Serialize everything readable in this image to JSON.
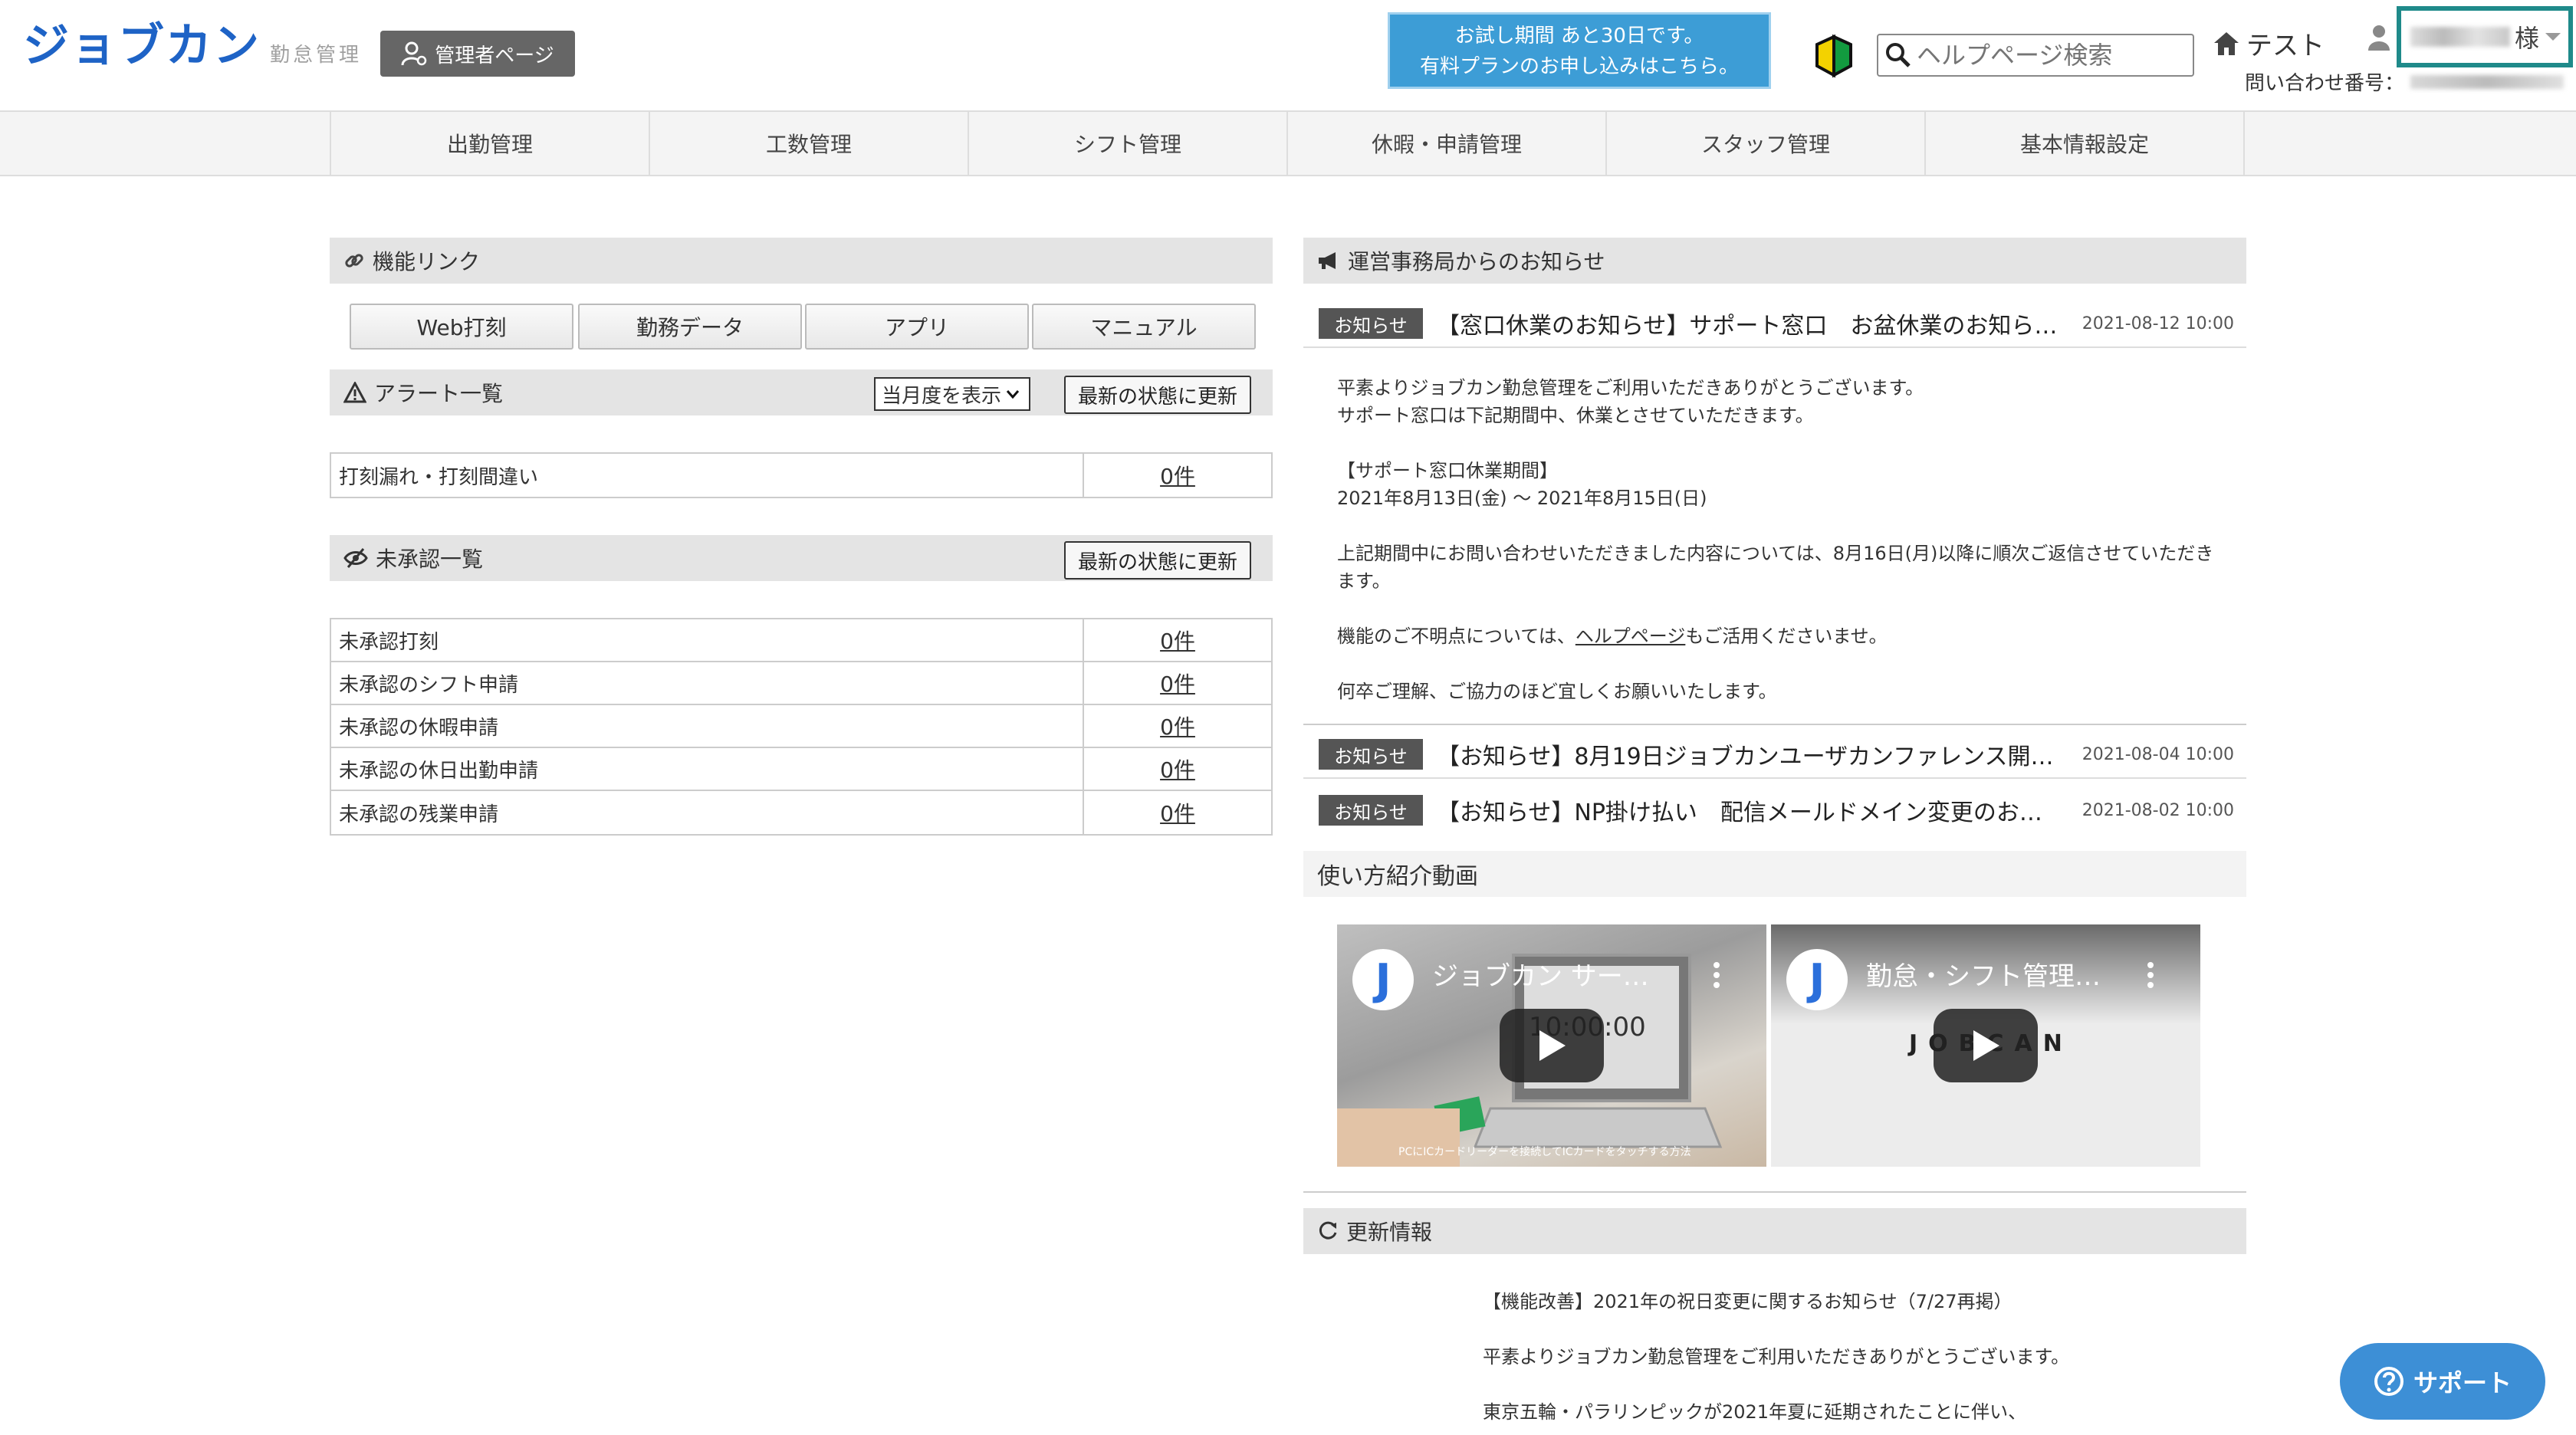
{
  "header": {
    "logo_main": "ジョブカン",
    "logo_sub": "勤怠管理",
    "admin_page_label": "管理者ページ",
    "trial_line1": "お試し期間 あと30日です。",
    "trial_line2": "有料プランのお申し込みはこちら。",
    "search_placeholder": "ヘルプページ検索",
    "home_label": "テスト",
    "user_suffix": "様",
    "contact_label": "問い合わせ番号："
  },
  "nav": {
    "items": [
      "出勤管理",
      "工数管理",
      "シフト管理",
      "休暇・申請管理",
      "スタッフ管理",
      "基本情報設定"
    ]
  },
  "function_links": {
    "title": "機能リンク",
    "buttons": [
      "Web打刻",
      "勤務データ",
      "アプリ",
      "マニュアル"
    ]
  },
  "alerts": {
    "title": "アラート一覧",
    "period_select": "当月度を表示",
    "refresh_label": "最新の状態に更新",
    "rows": [
      {
        "label": "打刻漏れ・打刻間違い",
        "count": "0件"
      }
    ]
  },
  "unapproved": {
    "title": "未承認一覧",
    "refresh_label": "最新の状態に更新",
    "rows": [
      {
        "label": "未承認打刻",
        "count": "0件"
      },
      {
        "label": "未承認のシフト申請",
        "count": "0件"
      },
      {
        "label": "未承認の休暇申請",
        "count": "0件"
      },
      {
        "label": "未承認の休日出勤申請",
        "count": "0件"
      },
      {
        "label": "未承認の残業申請",
        "count": "0件"
      }
    ]
  },
  "notices": {
    "title": "運営事務局からのお知らせ",
    "items": [
      {
        "badge": "お知らせ",
        "title": "【窓口休業のお知らせ】サポート窓口　お盆休業のお知ら…",
        "date": "2021-08-12 10:00"
      },
      {
        "badge": "お知らせ",
        "title": "【お知らせ】8月19日ジョブカンユーザカンファレンス開…",
        "date": "2021-08-04 10:00"
      },
      {
        "badge": "お知らせ",
        "title": "【お知らせ】NP掛け払い　配信メールドメイン変更のお…",
        "date": "2021-08-02 10:00"
      }
    ],
    "body": {
      "line1": "平素よりジョブカン勤怠管理をご利用いただきありがとうございます。",
      "line2": "サポート窓口は下記期間中、休業とさせていただきます。",
      "line3": "【サポート窓口休業期間】",
      "line4": "2021年8月13日(金) 〜 2021年8月15日(日)",
      "line5": "上記期間中にお問い合わせいただきました内容については、8月16日(月)以降に順次ご返信させていただき",
      "line6": "ます。",
      "line7_pre": "機能のご不明点については、",
      "line7_link": "ヘルプページ",
      "line7_post": "もご活用くださいませ。",
      "line8": "何卒ご理解、ご協力のほど宜しくお願いいたします。"
    }
  },
  "videos": {
    "title": "使い方紹介動画",
    "items": [
      {
        "title": "ジョブカン サー…",
        "overlay": "10:00:00",
        "caption": "PCにICカードリーダーを接続してICカードをタッチする方法"
      },
      {
        "title": "勤怠・シフト管理…",
        "overlay": "JOBCAN"
      }
    ]
  },
  "updates": {
    "title": "更新情報",
    "line1": "【機能改善】2021年の祝日変更に関するお知らせ（7/27再掲）",
    "line2": "平素よりジョブカン勤怠管理をご利用いただきありがとうございます。",
    "line3": "東京五輪・パラリンピックが2021年夏に延期されたことに伴い、"
  },
  "support_label": "サポート",
  "colors": {
    "brand": "#1e63c6",
    "trial_bg": "#3d9dd6",
    "highlight_border": "#1f8a8a",
    "support_bg": "#3d8fd6"
  }
}
